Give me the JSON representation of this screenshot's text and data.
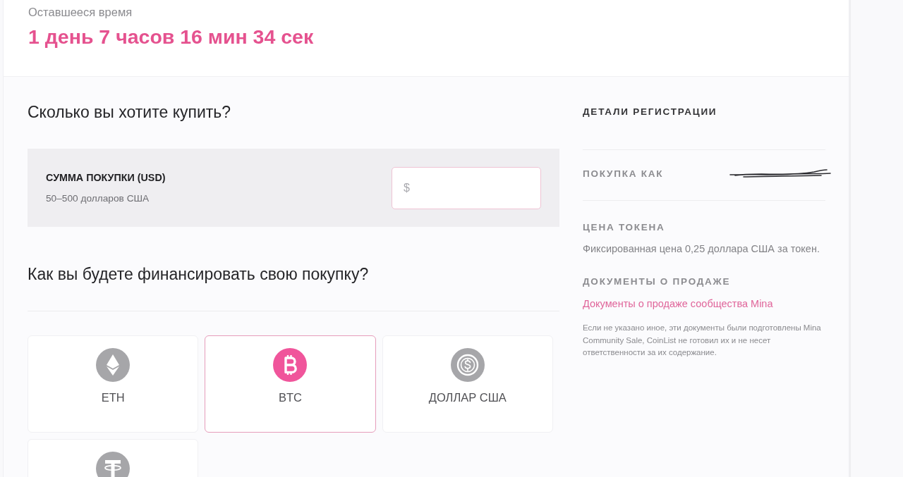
{
  "countdown": {
    "label": "Оставшееся время",
    "value": "1 день 7 часов 16 мин 34 сек"
  },
  "purchase": {
    "heading": "Сколько вы хотите купить?",
    "amount": {
      "label": "СУММА ПОКУПКИ (USD)",
      "hint": "50–500 долларов США",
      "placeholder": "$"
    }
  },
  "funding": {
    "heading": "Как вы будете финансировать свою покупку?",
    "options": [
      {
        "kind": "eth",
        "label": "ETH",
        "selected": false
      },
      {
        "kind": "btc",
        "label": "BTC",
        "selected": true
      },
      {
        "kind": "usd",
        "label": "ДОЛЛАР США",
        "selected": false
      },
      {
        "kind": "tether",
        "selected": false
      }
    ]
  },
  "registration": {
    "title": "ДЕТАЛИ РЕГИСТРАЦИИ",
    "purchase_as": {
      "label": "ПОКУПКА КАК",
      "redacted": true
    },
    "token_price": {
      "title": "ЦЕНА ТОКЕНА",
      "text": "Фиксированная цена 0,25 доллара США за токен."
    },
    "sale_documents": {
      "title": "ДОКУМЕНТЫ О ПРОДАЖЕ",
      "link": "Документы о продаже сообщества Mina",
      "note": "Если не указано иное, эти документы были подготовлены Mina Community Sale, CoinList не готовил их и не несет ответственности за их содержание."
    }
  }
}
